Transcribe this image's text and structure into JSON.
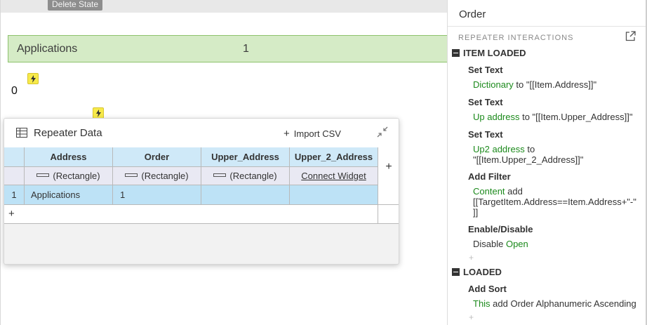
{
  "canvas": {
    "delete_state_label": "Delete State",
    "app_row": {
      "address": "Applications",
      "order": "1"
    },
    "zero_label": "0"
  },
  "repeater_data": {
    "title": "Repeater Data",
    "import_csv": "Import CSV",
    "add_column": "+",
    "add_row": "+",
    "columns": [
      {
        "header": "Address",
        "widget": "(Rectangle)"
      },
      {
        "header": "Order",
        "widget": "(Rectangle)"
      },
      {
        "header": "Upper_Address",
        "widget": "(Rectangle)"
      },
      {
        "header": "Upper_2_Address",
        "widget": "Connect Widget"
      }
    ],
    "rows": [
      {
        "index": "1",
        "cells": [
          "Applications",
          "1",
          "",
          ""
        ]
      }
    ]
  },
  "side_panel": {
    "title": "Order",
    "section": "REPEATER INTERACTIONS",
    "events": [
      {
        "name": "ITEM LOADED",
        "actions": [
          {
            "name": "Set Text",
            "target": "Dictionary",
            "text": " to \"[[Item.Address]]\""
          },
          {
            "name": "Set Text",
            "target": "Up address",
            "text": " to \"[[Item.Upper_Address]]\""
          },
          {
            "name": "Set Text",
            "target": "Up2 address",
            "text": " to",
            "text2": "\"[[Item.Upper_2_Address]]\""
          },
          {
            "name": "Add Filter",
            "target": "Content",
            "text": " add",
            "text2": "[[TargetItem.Address==Item.Address+\"-\"",
            "text3": "]]"
          },
          {
            "name": "Enable/Disable",
            "prefix": "Disable ",
            "target": "Open"
          }
        ],
        "add_action": "+"
      },
      {
        "name": "LOADED",
        "actions": [
          {
            "name": "Add Sort",
            "target": "This",
            "text": " add Order Alphanumeric Ascending"
          }
        ],
        "add_action": "+"
      }
    ]
  }
}
